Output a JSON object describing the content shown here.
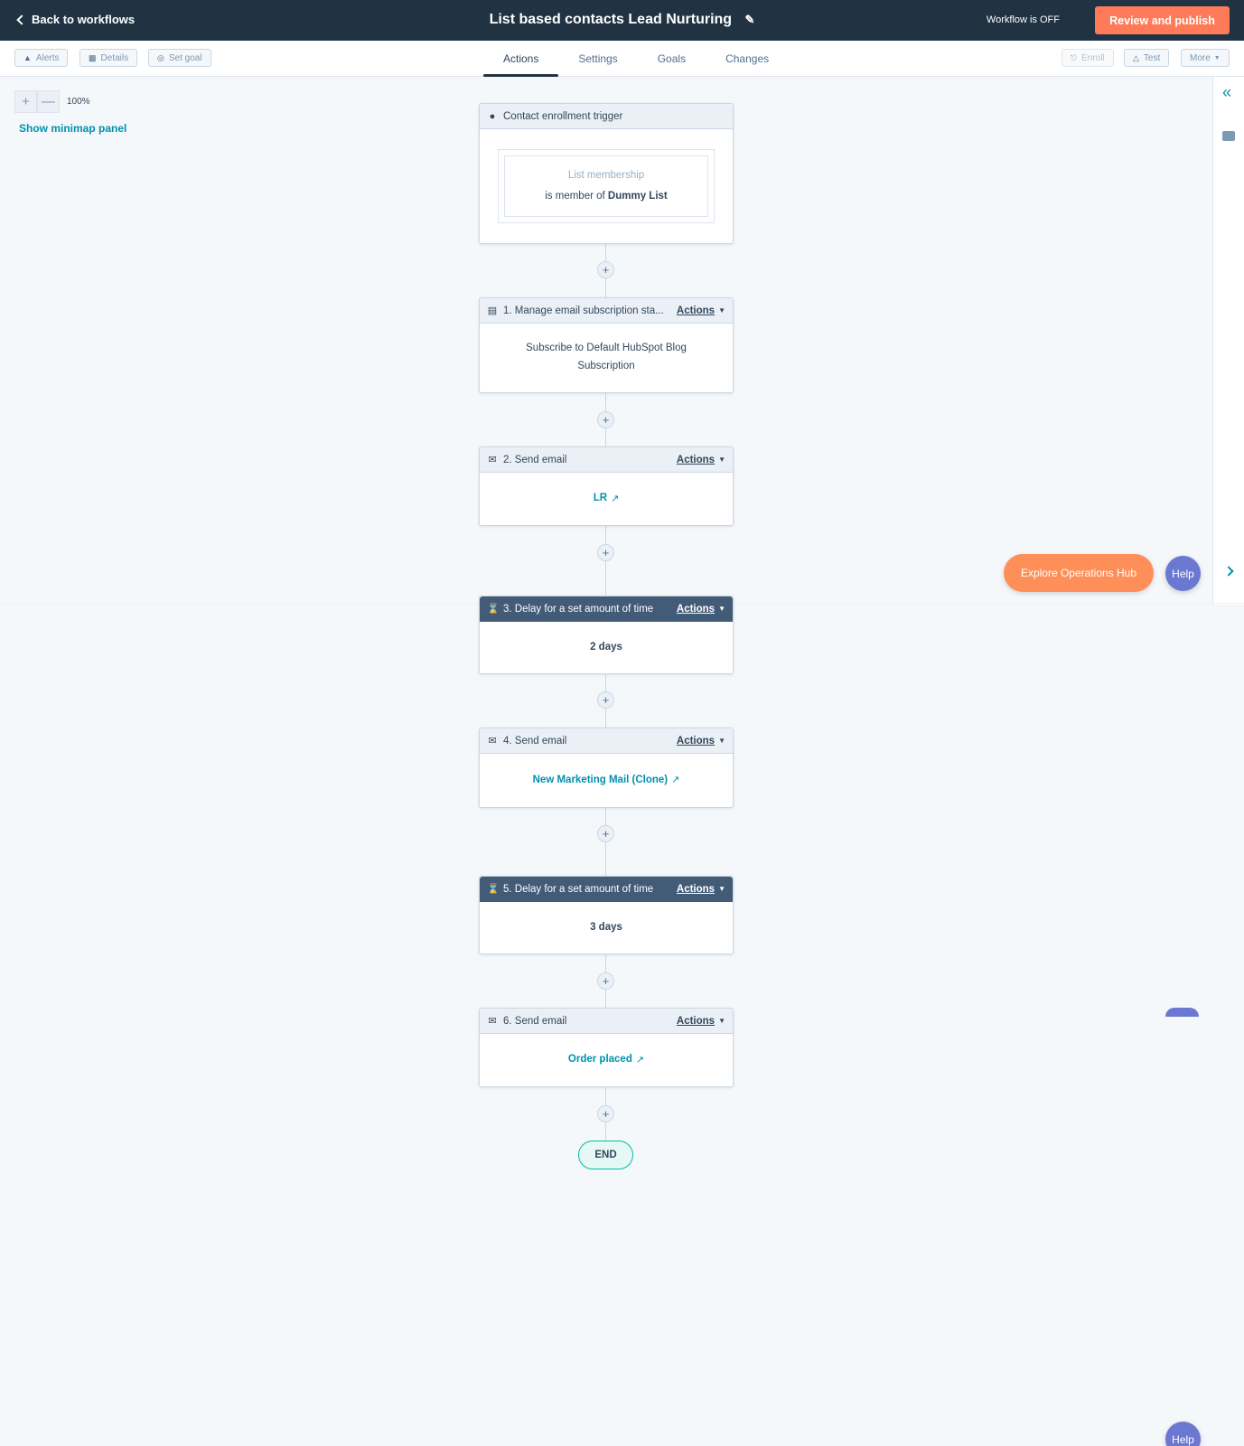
{
  "header": {
    "back_label": "Back to workflows",
    "title": "List based contacts Lead Nurturing",
    "status": "Workflow is OFF",
    "publish_label": "Review and publish"
  },
  "toolbar": {
    "alerts": "Alerts",
    "details": "Details",
    "set_goal": "Set goal",
    "enroll": "Enroll",
    "test": "Test",
    "more": "More"
  },
  "tabs": [
    {
      "label": "Actions",
      "active": true
    },
    {
      "label": "Settings",
      "active": false
    },
    {
      "label": "Goals",
      "active": false
    },
    {
      "label": "Changes",
      "active": false
    }
  ],
  "canvas": {
    "zoom_level": "100%",
    "minimap_label": "Show minimap panel"
  },
  "trigger": {
    "title": "Contact enrollment trigger",
    "filter_name": "List membership",
    "filter_prefix": "is member of",
    "filter_value": "Dummy List"
  },
  "steps": [
    {
      "title": "1. Manage email subscription sta...",
      "actions_label": "Actions",
      "body": "Subscribe to Default HubSpot Blog Subscription"
    },
    {
      "title": "2. Send email",
      "actions_label": "Actions",
      "body": "LR"
    },
    {
      "title": "3. Delay for a set amount of time",
      "actions_label": "Actions",
      "body": "2 days"
    },
    {
      "title": "4. Send email",
      "actions_label": "Actions",
      "body": "New Marketing Mail (Clone)"
    },
    {
      "title": "5. Delay for a set amount of time",
      "actions_label": "Actions",
      "body": "3 days"
    },
    {
      "title": "6. Send email",
      "actions_label": "Actions",
      "body": "Order placed"
    }
  ],
  "end_label": "END",
  "floating": {
    "explore_label": "Explore Operations Hub",
    "help_label": "Help"
  },
  "colors": {
    "topbar": "#213343",
    "primary_button": "#ff7a59",
    "link": "#0091ae",
    "delay_header": "#425b76",
    "help": "#6a78d1"
  }
}
